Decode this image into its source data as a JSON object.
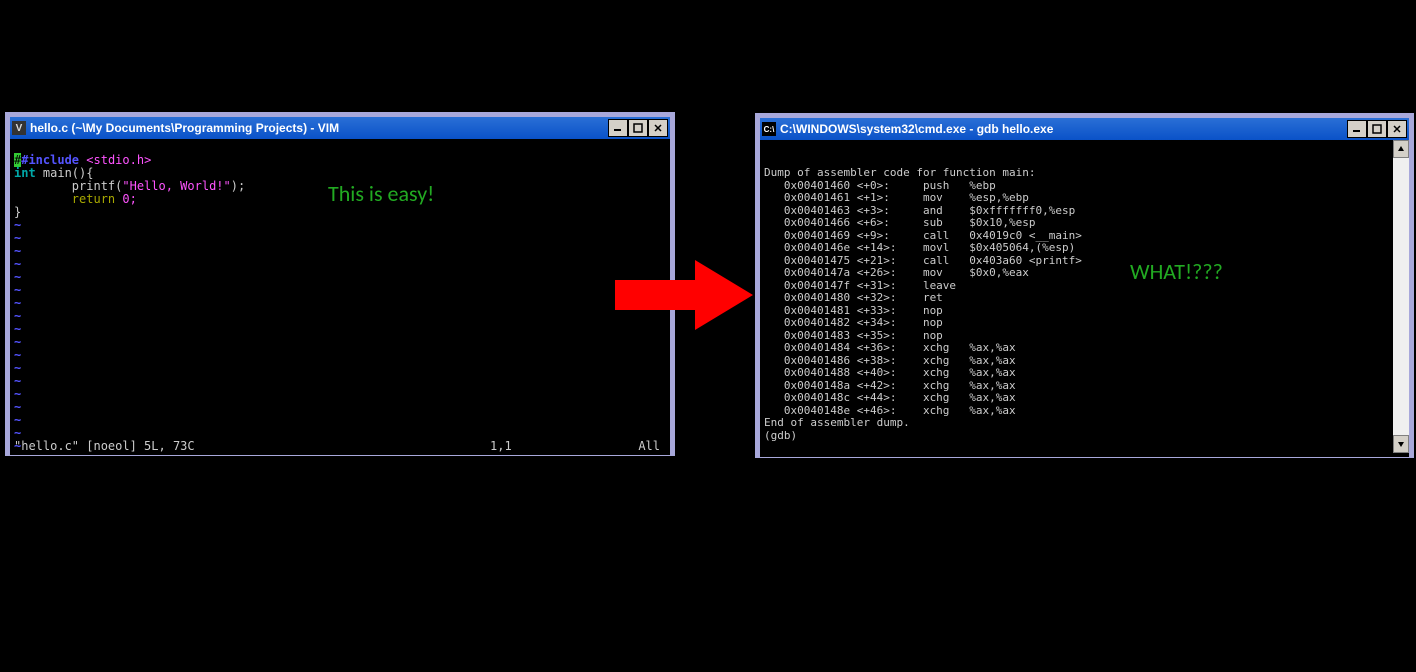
{
  "left_window": {
    "title": "hello.c (~\\My Documents\\Programming Projects) - VIM",
    "code": {
      "line1_kw": "#include",
      "line1_inc": "<stdio.h>",
      "line2_type": "int",
      "line2_rest": " main(){",
      "line3_indent": "        ",
      "line3_fn": "printf(",
      "line3_str": "\"Hello, World!\"",
      "line3_end": ");",
      "line4_indent": "        ",
      "line4_kw": "return",
      "line4_val": " 0;",
      "line5": "}"
    },
    "annotation": "This is easy!",
    "status_left": "\"hello.c\" [noeol] 5L, 73C",
    "status_mid": "1,1",
    "status_right": "All"
  },
  "right_window": {
    "title": "C:\\WINDOWS\\system32\\cmd.exe - gdb hello.exe",
    "annotation": "WHAT!???",
    "lines": [
      "Dump of assembler code for function main:",
      "   0x00401460 <+0>:     push   %ebp",
      "   0x00401461 <+1>:     mov    %esp,%ebp",
      "   0x00401463 <+3>:     and    $0xfffffff0,%esp",
      "   0x00401466 <+6>:     sub    $0x10,%esp",
      "   0x00401469 <+9>:     call   0x4019c0 <__main>",
      "   0x0040146e <+14>:    movl   $0x405064,(%esp)",
      "   0x00401475 <+21>:    call   0x403a60 <printf>",
      "   0x0040147a <+26>:    mov    $0x0,%eax",
      "   0x0040147f <+31>:    leave",
      "   0x00401480 <+32>:    ret",
      "   0x00401481 <+33>:    nop",
      "   0x00401482 <+34>:    nop",
      "   0x00401483 <+35>:    nop",
      "   0x00401484 <+36>:    xchg   %ax,%ax",
      "   0x00401486 <+38>:    xchg   %ax,%ax",
      "   0x00401488 <+40>:    xchg   %ax,%ax",
      "   0x0040148a <+42>:    xchg   %ax,%ax",
      "   0x0040148c <+44>:    xchg   %ax,%ax",
      "   0x0040148e <+46>:    xchg   %ax,%ax",
      "End of assembler dump.",
      "(gdb) "
    ]
  },
  "buttons": {
    "minimize": "—",
    "maximize": "□",
    "close": "✕"
  }
}
